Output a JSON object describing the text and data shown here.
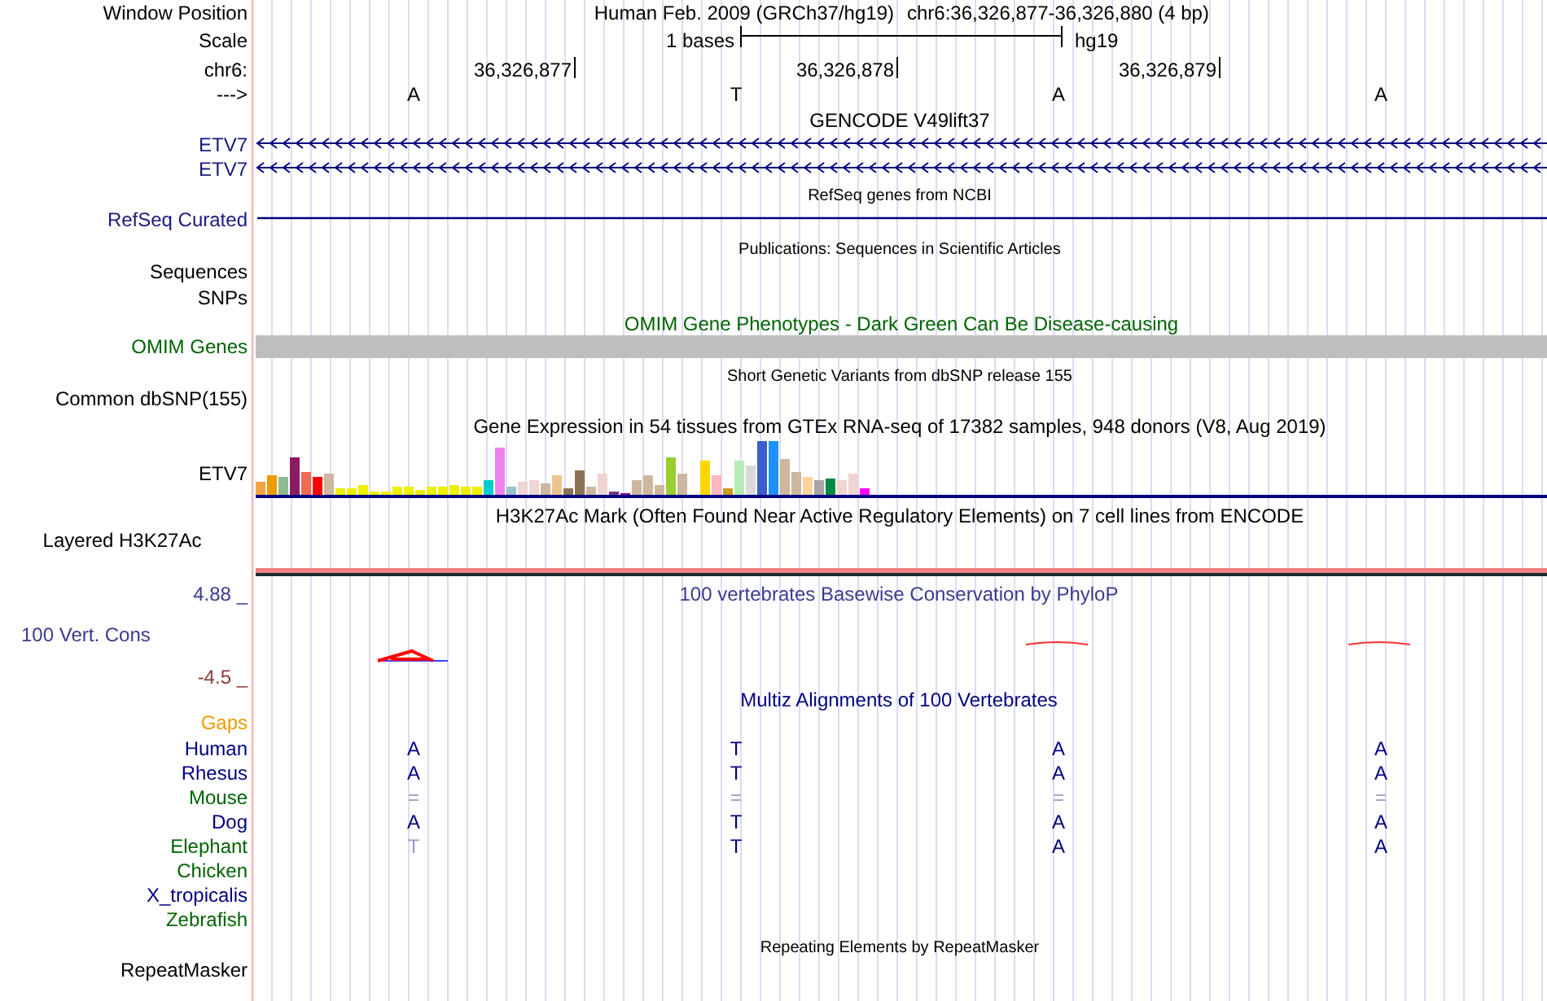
{
  "header": {
    "position_label": "Window Position",
    "assembly_title": "Human Feb. 2009 (GRCh37/hg19)",
    "position": "chr6:36,326,877-36,326,880 (4 bp)",
    "scale_label": "Scale",
    "scale_text": "1 bases",
    "scale_assembly": "hg19",
    "chrom_label": "chr6:",
    "ticks": [
      "36,326,877",
      "36,326,878",
      "36,326,879"
    ],
    "strand_label": "--->",
    "bases": [
      "A",
      "T",
      "A",
      "A"
    ]
  },
  "tracks": [
    {
      "kind": "gene",
      "title": "GENCODE V49lift37",
      "rows": [
        "ETV7",
        "ETV7"
      ]
    },
    {
      "kind": "gene",
      "title": "RefSeq genes from NCBI",
      "rows": [
        "RefSeq Curated"
      ]
    },
    {
      "kind": "text",
      "title": "Publications: Sequences in Scientific Articles",
      "labels": [
        "Sequences",
        "SNPs"
      ]
    },
    {
      "kind": "bar",
      "title": "OMIM Gene Phenotypes - Dark Green Can Be Disease-causing",
      "label": "OMIM Genes"
    },
    {
      "kind": "text",
      "title": "Short Genetic Variants from dbSNP release 155",
      "labels": [
        "Common dbSNP(155)"
      ]
    },
    {
      "kind": "expression",
      "title": "Gene Expression in 54 tissues from GTEx RNA-seq of 17382 samples, 948 donors (V8, Aug 2019)",
      "label": "ETV7"
    },
    {
      "kind": "signal",
      "title": "H3K27Ac Mark (Often Found Near Active Regulatory Elements) on 7 cell lines from ENCODE",
      "label": "Layered H3K27Ac"
    },
    {
      "kind": "wiggle",
      "title": "100 vertebrates Basewise Conservation by PhyloP",
      "label": "100 Vert. Cons",
      "max": "4.88 _",
      "min": "-4.5 _"
    },
    {
      "kind": "multiz",
      "title": "Multiz Alignments of 100 Vertebrates",
      "gaps_label": "Gaps",
      "species": [
        {
          "name": "Human",
          "color": "#000080",
          "bases": [
            {
              "base": "A",
              "dimmed": false
            },
            {
              "base": "T",
              "dimmed": false
            },
            {
              "base": "A",
              "dimmed": false
            },
            {
              "base": "A",
              "dimmed": false
            }
          ]
        },
        {
          "name": "Rhesus",
          "color": "#000080",
          "bases": [
            {
              "base": "A",
              "dimmed": false
            },
            {
              "base": "T",
              "dimmed": false
            },
            {
              "base": "A",
              "dimmed": false
            },
            {
              "base": "A",
              "dimmed": false
            }
          ]
        },
        {
          "name": "Mouse",
          "color": "#006400",
          "bases": [
            {
              "base": "=",
              "dimmed": true
            },
            {
              "base": "=",
              "dimmed": true
            },
            {
              "base": "=",
              "dimmed": true
            },
            {
              "base": "=",
              "dimmed": true
            }
          ]
        },
        {
          "name": "Dog",
          "color": "#000080",
          "bases": [
            {
              "base": "A",
              "dimmed": false
            },
            {
              "base": "T",
              "dimmed": false
            },
            {
              "base": "A",
              "dimmed": false
            },
            {
              "base": "A",
              "dimmed": false
            }
          ]
        },
        {
          "name": "Elephant",
          "color": "#006400",
          "bases": [
            {
              "base": "T",
              "dimmed": true
            },
            {
              "base": "T",
              "dimmed": false
            },
            {
              "base": "A",
              "dimmed": false
            },
            {
              "base": "A",
              "dimmed": false
            }
          ]
        },
        {
          "name": "Chicken",
          "color": "#006400"
        },
        {
          "name": "X_tropicalis",
          "color": "#000080"
        },
        {
          "name": "Zebrafish",
          "color": "#006400"
        }
      ]
    },
    {
      "kind": "text",
      "title": "Repeating Elements by RepeatMasker",
      "labels": [
        "RepeatMasker"
      ]
    }
  ]
}
